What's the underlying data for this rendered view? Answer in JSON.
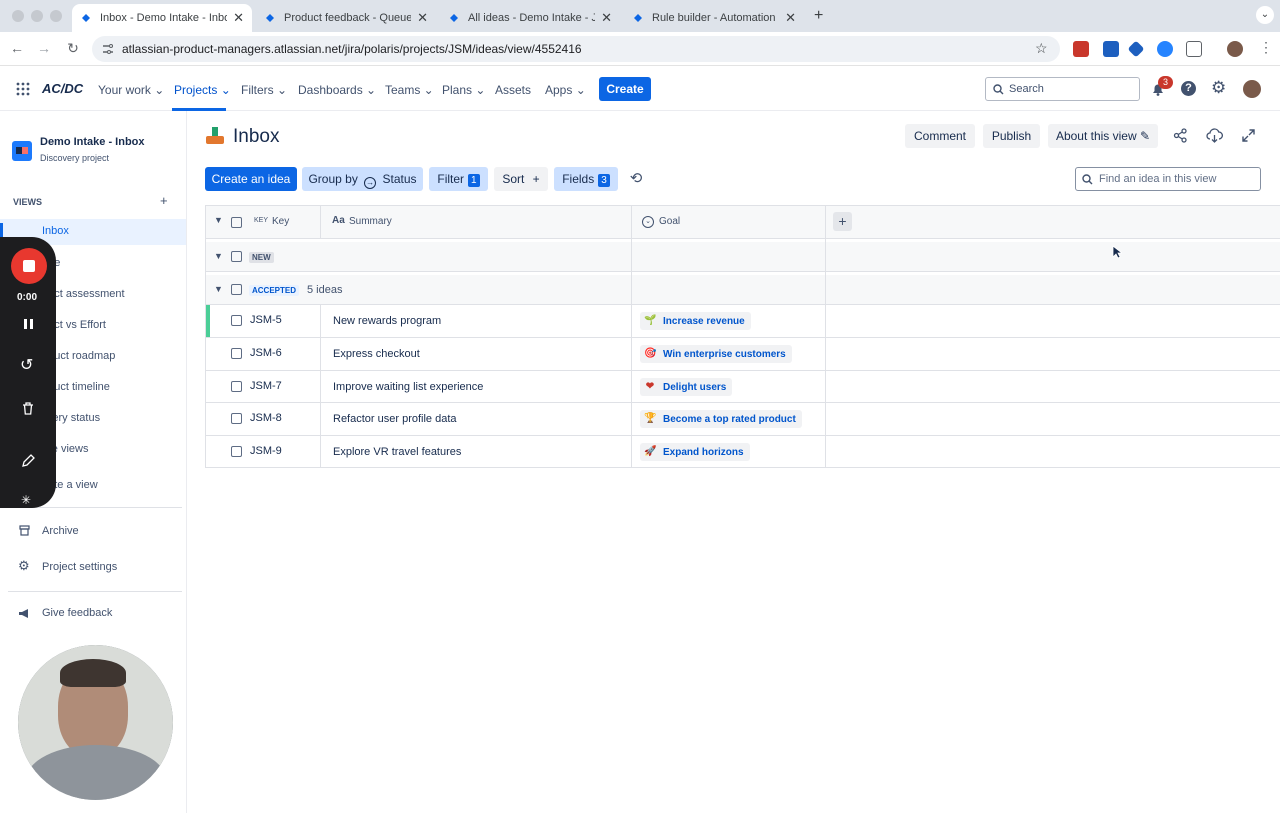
{
  "browser": {
    "tabs": [
      {
        "title": "Inbox - Demo Intake - Inbox -"
      },
      {
        "title": "Product feedback - Queues -"
      },
      {
        "title": "All ideas - Demo Intake - JSM"
      },
      {
        "title": "Rule builder - Automation - Ji"
      }
    ],
    "url": "atlassian-product-managers.atlassian.net/jira/polaris/projects/JSM/ideas/view/4552416"
  },
  "jira_nav": {
    "logo": "AC/DC",
    "items": [
      "Your work",
      "Projects",
      "Filters",
      "Dashboards",
      "Teams",
      "Plans",
      "Assets",
      "Apps"
    ],
    "create": "Create",
    "search_placeholder": "Search",
    "notification_count": "3"
  },
  "sidebar": {
    "project_name": "Demo Intake - Inbox",
    "project_type": "Discovery project",
    "views_header": "VIEWS",
    "views": [
      "Inbox",
      "age",
      "pact assessment",
      "pact vs Effort",
      "oduct roadmap",
      "oduct timeline",
      "livery status",
      "ore views",
      "eate a view"
    ],
    "archive": "Archive",
    "project_settings": "Project settings",
    "give_feedback": "Give feedback"
  },
  "recorder": {
    "time": "0:00"
  },
  "page": {
    "title": "Inbox",
    "comment": "Comment",
    "publish": "Publish",
    "about": "About this view"
  },
  "toolbar": {
    "create_idea": "Create an idea",
    "group_by": "Group by",
    "group_by_value": "Status",
    "filter": "Filter",
    "filter_count": "1",
    "sort": "Sort",
    "fields": "Fields",
    "fields_count": "3",
    "find_placeholder": "Find an idea in this view"
  },
  "table": {
    "key_prefix": "KEY",
    "col_key": "Key",
    "col_summary_prefix": "Aa",
    "col_summary": "Summary",
    "col_goal": "Goal",
    "groups": [
      {
        "name": "NEW",
        "count": ""
      },
      {
        "name": "ACCEPTED",
        "count": "5 ideas"
      }
    ],
    "rows": [
      {
        "key": "JSM-5",
        "summary": "New rewards program",
        "goal": "Increase revenue",
        "goal_icon": "sprout-icon",
        "goal_glyph": "🌱"
      },
      {
        "key": "JSM-6",
        "summary": "Express checkout",
        "goal": "Win enterprise customers",
        "goal_icon": "target-icon",
        "goal_glyph": "🎯"
      },
      {
        "key": "JSM-7",
        "summary": "Improve waiting list experience",
        "goal": "Delight users",
        "goal_icon": "heart-icon",
        "goal_glyph": "❤"
      },
      {
        "key": "JSM-8",
        "summary": "Refactor user profile data",
        "goal": "Become a top rated product",
        "goal_icon": "trophy-icon",
        "goal_glyph": "🏆"
      },
      {
        "key": "JSM-9",
        "summary": "Explore VR travel features",
        "goal": "Expand horizons",
        "goal_icon": "rocket-icon",
        "goal_glyph": "🚀"
      }
    ]
  }
}
